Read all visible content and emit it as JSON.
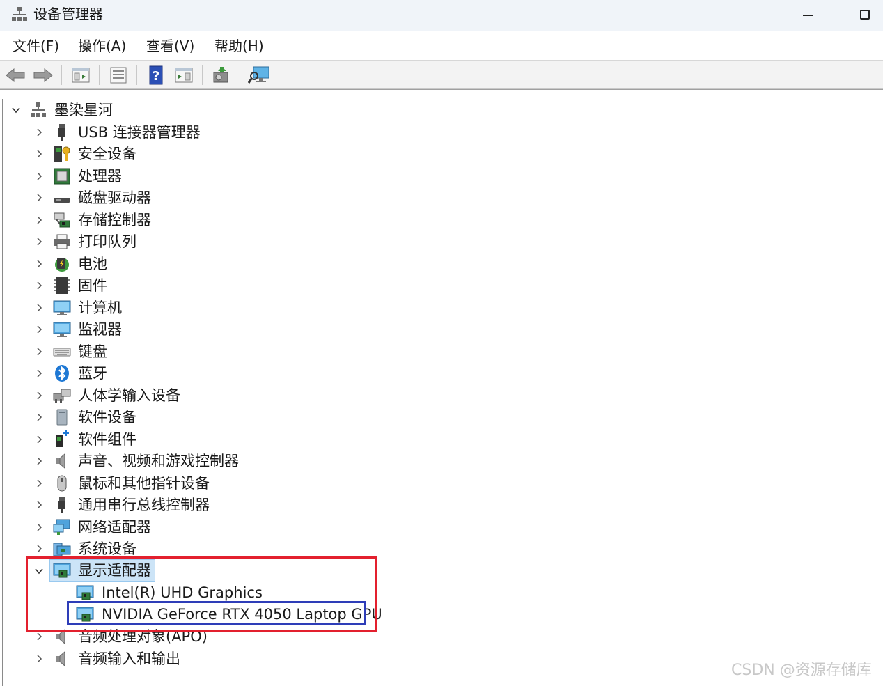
{
  "window": {
    "title": "设备管理器",
    "controls": [
      "minimize-icon",
      "maximize-icon"
    ]
  },
  "menubar": {
    "file": "文件(F)",
    "action": "操作(A)",
    "view": "查看(V)",
    "help": "帮助(H)"
  },
  "toolbar": {
    "buttons": [
      "back-arrow-icon",
      "forward-arrow-icon",
      "show-hide-console-tree-icon",
      "properties-icon",
      "help-icon",
      "action-pane-icon",
      "update-driver-icon",
      "scan-hardware-changes-icon"
    ]
  },
  "tree": {
    "root": "墨染星河",
    "categories": [
      "USB 连接器管理器",
      "安全设备",
      "处理器",
      "磁盘驱动器",
      "存储控制器",
      "打印队列",
      "电池",
      "固件",
      "计算机",
      "监视器",
      "键盘",
      "蓝牙",
      "人体学输入设备",
      "软件设备",
      "软件组件",
      "声音、视频和游戏控制器",
      "鼠标和其他指针设备",
      "通用串行总线控制器",
      "网络适配器",
      "系统设备"
    ],
    "expanded": {
      "label": "显示适配器",
      "children": [
        "Intel(R) UHD Graphics",
        "NVIDIA GeForce RTX 4050 Laptop GPU"
      ]
    },
    "after": [
      "音频处理对象(APO)",
      "音频输入和输出"
    ]
  },
  "watermark": "CSDN @资源存储库",
  "colors": {
    "highlight_red": "#e3202e",
    "highlight_blue": "#2e3db8",
    "selection": "#cce4f7"
  }
}
